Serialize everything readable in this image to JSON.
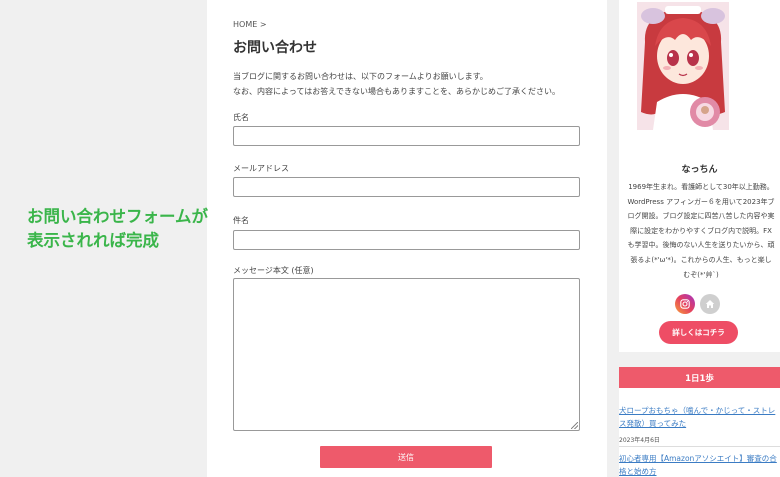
{
  "page": {
    "breadcrumb": "HOME >",
    "title": "お問い合わせ",
    "intro_line1": "当ブログに関するお問い合わせは、以下のフォームよりお願いします。",
    "intro_line2": "なお、内容によってはお答えできない場合もありますことを、あらかじめご了承ください。"
  },
  "form": {
    "name_label": "氏名",
    "email_label": "メールアドレス",
    "subject_label": "件名",
    "message_label": "メッセージ本文 (任意)",
    "name_value": "",
    "email_value": "",
    "subject_value": "",
    "message_value": "",
    "submit_label": "送信"
  },
  "annotation": {
    "line1": "お問い合わせフォームが",
    "line2": "表示されれば完成"
  },
  "profile": {
    "name": "なっちん",
    "bio": "1969年生まれ。看護師として30年以上勤務。WordPress アフィンガー６を用いて2023年ブログ開設。ブログ設定に四苦八苦した内容や実際に設定をわかりやすくブログ内で説明。FXも学習中。後悔のない人生を送りたいから、頑張るよ(*'ω'*)。これからの人生、もっと楽しむぞ(*'艸`)",
    "more_button": "詳しくはコチラ",
    "social_icons": [
      "instagram-icon",
      "home-icon"
    ]
  },
  "widget": {
    "title": "1日1歩",
    "posts": [
      {
        "title": "犬ロープおもちゃ（噛んで・かじって・ストレス発散）買ってみた",
        "date": "2023年4月6日"
      },
      {
        "title": "初心者専用【Amazonアソシエイト】審査の合格と始め方",
        "date": ""
      }
    ]
  },
  "colors": {
    "accent": "#ee5a6b",
    "annotation_green": "#3ab54a",
    "link_blue": "#3b7cc4",
    "background": "#f0f0f0"
  }
}
